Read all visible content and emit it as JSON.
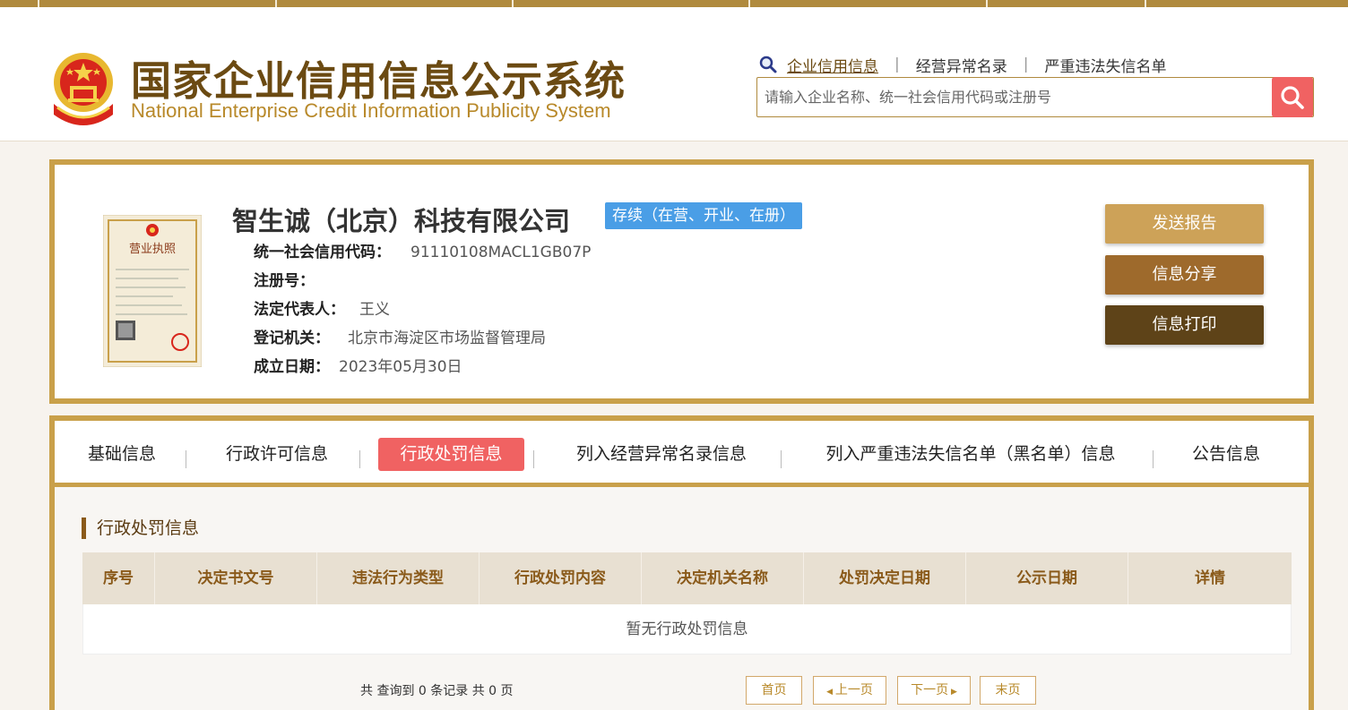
{
  "header": {
    "title_cn": "国家企业信用信息公示系统",
    "title_en": "National Enterprise Credit Information Publicity System",
    "nav": [
      "企业信用信息",
      "经营异常名录",
      "严重违法失信名单"
    ],
    "search_placeholder": "请输入企业名称、统一社会信用代码或注册号"
  },
  "company": {
    "name": "智生诚（北京）科技有限公司",
    "status": "存续（在营、开业、在册）",
    "fields": [
      {
        "label": "统一社会信用代码：",
        "value": "91110108MACL1GB07P"
      },
      {
        "label": "注册号：",
        "value": ""
      },
      {
        "label": "法定代表人：",
        "value": "王义"
      },
      {
        "label": "登记机关：",
        "value": "北京市海淀区市场监督管理局"
      },
      {
        "label": "成立日期：",
        "value": "2023年05月30日"
      }
    ],
    "license_title": "营业执照",
    "actions": [
      "发送报告",
      "信息分享",
      "信息打印"
    ]
  },
  "tabs": [
    "基础信息",
    "行政许可信息",
    "行政处罚信息",
    "列入经营异常名录信息",
    "列入严重违法失信名单（黑名单）信息",
    "公告信息"
  ],
  "section": {
    "title": "行政处罚信息",
    "columns": [
      "序号",
      "决定书文号",
      "违法行为类型",
      "行政处罚内容",
      "决定机关名称",
      "处罚决定日期",
      "公示日期",
      "详情"
    ],
    "empty_text": "暂无行政处罚信息"
  },
  "pager": {
    "summary": "共 查询到 0 条记录 共 0 页",
    "first": "首页",
    "prev": "上一页",
    "next": "下一页",
    "last": "末页"
  },
  "colors": {
    "gold": "#c9a04a",
    "brown": "#6b4a12",
    "accent_red": "#f06262",
    "status_blue": "#4a9ee6"
  }
}
